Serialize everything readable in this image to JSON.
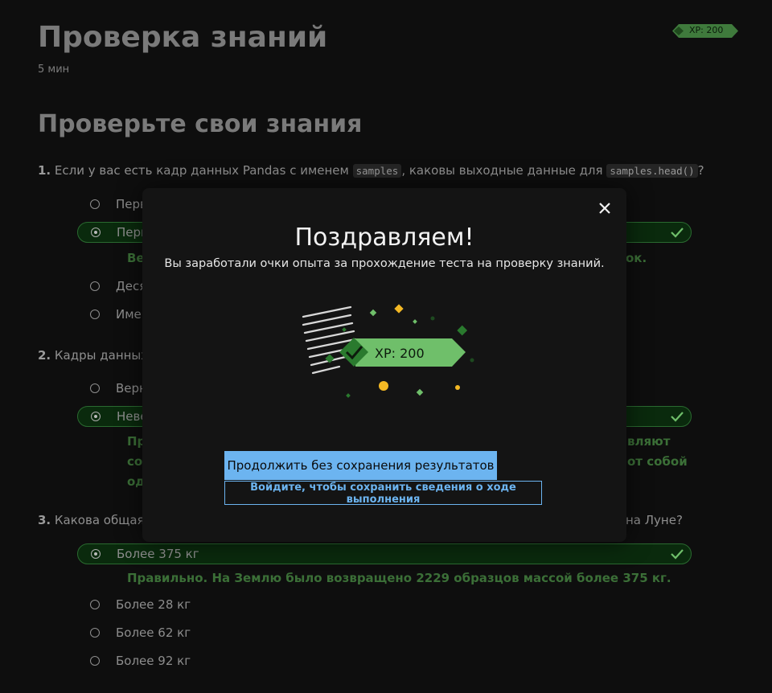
{
  "header": {
    "title": "Проверка знаний",
    "duration": "5 мин",
    "xp_badge": "XP: 200"
  },
  "section_title": "Проверьте свои знания",
  "questions": [
    {
      "number": "1.",
      "text_before": " Если у вас есть кадр данных Pandas с именем ",
      "code1": "samples",
      "text_middle": ", каковы выходные данные для ",
      "code2": "samples.head()",
      "text_after": "?",
      "options": [
        {
          "label": "Перв",
          "selected": false
        },
        {
          "label": "Перв",
          "selected": true
        },
        {
          "label": "Деся",
          "selected": false
        },
        {
          "label": "Имен",
          "selected": false
        }
      ],
      "feedback": {
        "left": "Ве",
        "right": "ок."
      }
    },
    {
      "number": "2.",
      "text": " Кадры данных и",
      "options": [
        {
          "label": "Верн",
          "selected": false
        },
        {
          "label": "Неве",
          "selected": true
        }
      ],
      "feedback": {
        "left_lines": [
          "Пр",
          "соб",
          "од"
        ],
        "right_lines": [
          "вляют",
          "от собой"
        ]
      }
    },
    {
      "number": "3.",
      "text_left": " Какова общая м",
      "text_right": "на Луне?",
      "options": [
        {
          "label": "Более 375 кг",
          "selected": true
        },
        {
          "label": "Более 28 кг",
          "selected": false
        },
        {
          "label": "Более 62 кг",
          "selected": false
        },
        {
          "label": "Более 92 кг",
          "selected": false
        }
      ],
      "feedback": "Правильно. На Землю было возвращено 2229 образцов массой более 375 кг."
    }
  ],
  "modal": {
    "title": "Поздравляем!",
    "description": "Вы заработали очки опыта за прохождение теста на проверку знаний.",
    "xp_label": "XP: 200",
    "continue_button": "Продолжить без сохранения результатов",
    "signin_button": "Войдите, чтобы сохранить сведения о ходе выполнения"
  },
  "colors": {
    "accent_green": "#6fbf6a",
    "dark_green": "#2a7a2e",
    "feedback_green": "#3b6f37",
    "selected_bg": "#0a2a0d",
    "primary_blue": "#6cb4f0",
    "confetti_yellow": "#f3b824",
    "modal_bg": "#141414"
  },
  "icons": [
    "checkmark-icon",
    "close-icon",
    "radio-icon",
    "xp-badge-icon"
  ]
}
